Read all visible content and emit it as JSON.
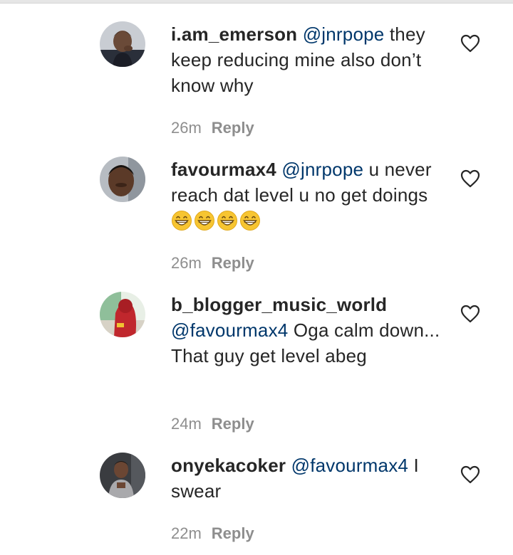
{
  "comments": [
    {
      "username": "i.am_emerson",
      "mention": "@jnrpope",
      "text": " they keep reducing mine also don’t know why",
      "time": "26m",
      "reply": "Reply",
      "avatar_icon": "avatar-photo-icon"
    },
    {
      "username": "favourmax4",
      "mention": "@jnrpope",
      "text": " u never reach dat level u no get doings",
      "emoji": [
        "😁",
        "😁",
        "😁",
        "😁"
      ],
      "time": "26m",
      "reply": "Reply",
      "avatar_icon": "avatar-photo-icon"
    },
    {
      "username": "b_blogger_music_world",
      "mention": "@favourmax4",
      "text": " Oga calm down... That guy get level abeg",
      "time": "24m",
      "reply": "Reply",
      "avatar_icon": "avatar-photo-icon"
    },
    {
      "username": "onyekacoker",
      "mention": "@favourmax4",
      "text": " I swear",
      "time": "22m",
      "reply": "Reply",
      "avatar_icon": "avatar-photo-icon"
    }
  ],
  "colors": {
    "mention": "#00376b",
    "meta": "#8e8e8e",
    "text": "#262626"
  },
  "icons": {
    "like": "heart-outline-icon"
  }
}
